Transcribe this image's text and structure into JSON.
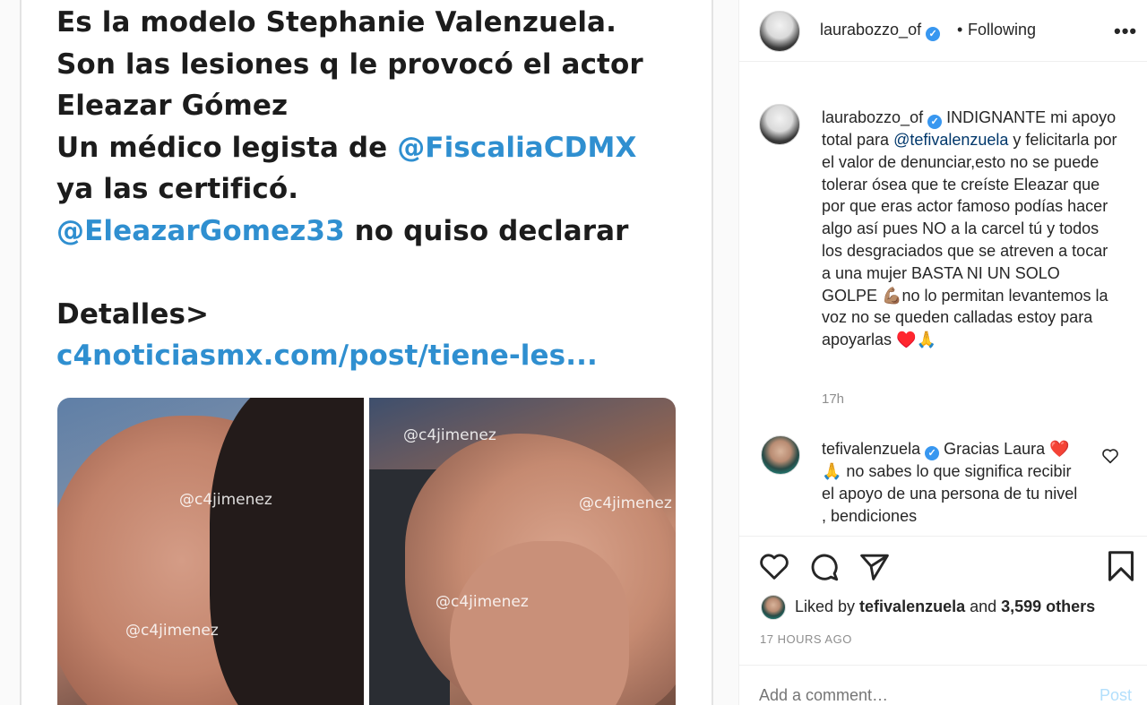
{
  "tweet": {
    "lines": [
      "Es la modelo Stephanie Valenzuela.",
      "Son las lesiones q le provocó el actor",
      "Eleazar Gómez"
    ],
    "line4_pre": "Un médico legista de ",
    "line4_mention": "@FiscaliaCDMX",
    "line5": "ya las certificó.",
    "line6_mention": "@EleazarGomez33",
    "line6_post": " no quiso declarar",
    "details": "Detalles>",
    "link": "c4noticiasmx.com/post/tiene-les..."
  },
  "photos": {
    "watermark": "@c4jimenez"
  },
  "header": {
    "username": "laurabozzo_of",
    "separator": "•",
    "follow_status": "Following",
    "more_icon": "more-horizontal-icon"
  },
  "caption": {
    "username": "laurabozzo_of",
    "text_pre": " INDIGNANTE mi apoyo total para ",
    "mention": "@tefivalenzuela",
    "text_post": " y felicitarla por el valor de denunciar,esto no se puede tolerar ósea que te creíste Eleazar que por que eras actor famoso podías hacer algo así pues NO a la carcel tú y todos los desgraciados que se atreven a tocar a una mujer BASTA NI UN SOLO GOLPE 💪🏽no lo permitan levantemos la voz no se queden calladas estoy para apoyarlas ♥️🙏",
    "time": "17h"
  },
  "reply": {
    "username": "tefivalenzuela",
    "text": " Gracias Laura ❤️🙏 no sabes lo que significa recibir el apoyo de una persona de tu nivel , bendiciones"
  },
  "likes": {
    "prefix": "Liked by ",
    "user": "tefivalenzuela",
    "mid": " and ",
    "others": "3,599 others"
  },
  "timestamp": "17 HOURS AGO",
  "comment_box": {
    "placeholder": "Add a comment…",
    "post_label": "Post"
  },
  "colors": {
    "link_blue": "#00376b",
    "verified_blue": "#3897f0",
    "tweet_mention": "#2f8fd0",
    "post_disabled": "#b2dffc"
  }
}
